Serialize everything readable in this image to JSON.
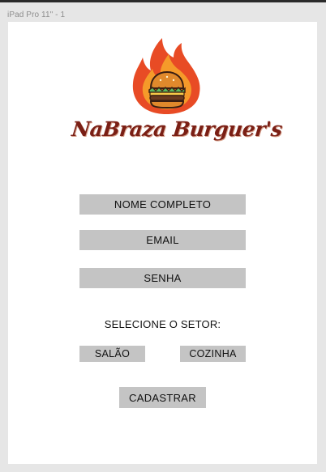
{
  "canvas": {
    "frame_label": "iPad Pro 11\" - 1"
  },
  "brand": {
    "name": "NaBraza Burguer's",
    "logo_icon": "flaming-burger-icon",
    "colors": {
      "flame_outer": "#e84b25",
      "flame_inner": "#f59a2a",
      "text": "#7a1f15"
    }
  },
  "form": {
    "nome_label": "NOME COMPLETO",
    "email_label": "EMAIL",
    "senha_label": "SENHA",
    "sector_prompt": "SELECIONE O SETOR:",
    "sector_options": [
      "SALÃO",
      "COZINHA"
    ],
    "submit_label": "CADASTRAR",
    "field_color": "#c4c4c4"
  }
}
